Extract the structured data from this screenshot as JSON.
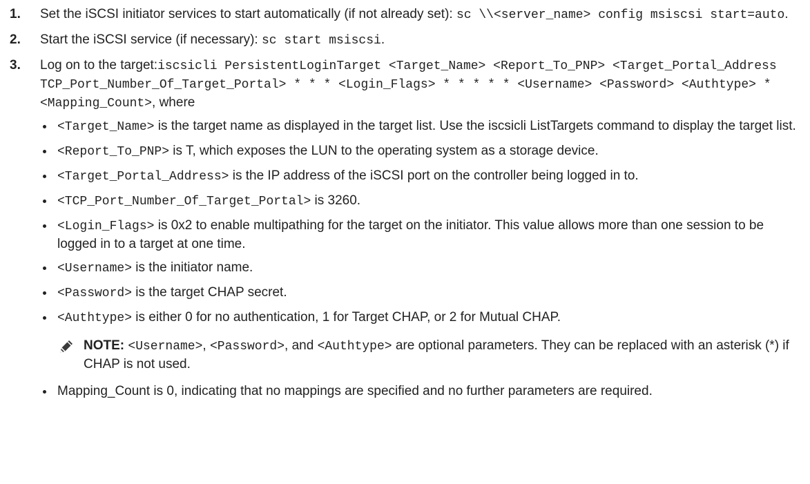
{
  "steps": [
    {
      "num": "1.",
      "parts": [
        "Set the iSCSI initiator services to start automatically (if not already set): ",
        "sc \\\\<server_name> config msiscsi start=auto",
        "."
      ]
    },
    {
      "num": "2.",
      "parts": [
        "Start the iSCSI service (if necessary): ",
        "sc start msiscsi",
        "."
      ]
    },
    {
      "num": "3.",
      "parts": [
        "Log on to the target:",
        "iscsicli PersistentLoginTarget <Target_Name> <Report_To_PNP> <Target_Portal_Address TCP_Port_Number_Of_Target_Portal> * * * <Login_Flags> * * * * * <Username> <Password> <Authtype> * <Mapping_Count>",
        ", where"
      ]
    }
  ],
  "bullets": [
    {
      "code": "<Target_Name>",
      "text": " is the target name as displayed in the target list. Use the iscsicli ListTargets command to display the target list."
    },
    {
      "code": "<Report_To_PNP>",
      "text": " is T, which exposes the LUN to the operating system as a storage device."
    },
    {
      "code": "<Target_Portal_Address>",
      "text": " is the IP address of the iSCSI port on the controller being logged in to."
    },
    {
      "code": "<TCP_Port_Number_Of_Target_Portal>",
      "text": " is 3260."
    },
    {
      "code": "<Login_Flags>",
      "text": " is 0x2 to enable multipathing for the target on the initiator. This value allows more than one session to be logged in to a target at one time."
    },
    {
      "code": "<Username>",
      "text": " is the initiator name."
    },
    {
      "code": "<Password>",
      "text": " is the target CHAP secret."
    },
    {
      "code": "<Authtype>",
      "text": " is either 0 for no authentication, 1 for Target CHAP, or 2 for Mutual CHAP."
    }
  ],
  "note": {
    "icon": "pencil-note-icon",
    "label": "NOTE:",
    "code1": "<Username>",
    "sep1": ", ",
    "code2": "<Password>",
    "sep2": ", and ",
    "code3": "<Authtype>",
    "text": " are optional parameters. They can be replaced with an asterisk (*) if CHAP is not used."
  },
  "last_bullet": "Mapping_Count is 0, indicating that no mappings are specified and no further parameters are required."
}
